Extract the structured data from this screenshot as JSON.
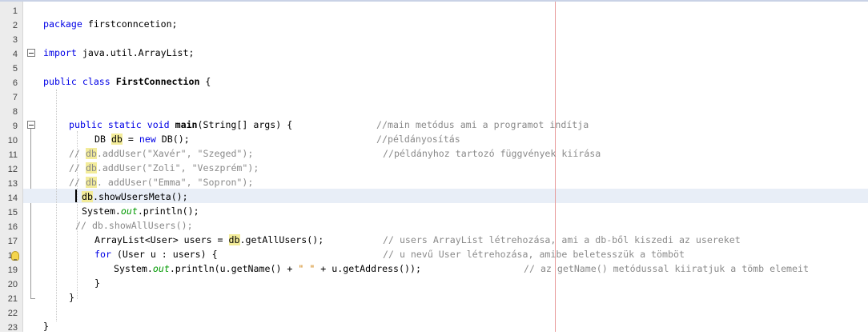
{
  "line_numbers": [
    "1",
    "2",
    "3",
    "4",
    "5",
    "6",
    "7",
    "8",
    "9",
    "10",
    "11",
    "12",
    "13",
    "14",
    "15",
    "16",
    "17",
    "18",
    "19",
    "20",
    "21",
    "22",
    "23"
  ],
  "code": {
    "l2": {
      "kw": "package",
      "rest": " firstconncetion;"
    },
    "l4": {
      "kw": "import",
      "rest": " java.util.ArrayList;"
    },
    "l6": {
      "kw": "public class",
      "name": " FirstConnection",
      "rest": " {"
    },
    "l9": {
      "kw": "public static void",
      "name": " main",
      "rest": "(String[] args) {",
      "comment": "//main metódus ami a programot indítja"
    },
    "l10": {
      "a": "DB ",
      "hl": "db",
      "b": " = ",
      "kw": "new",
      "c": " DB();",
      "comment": "//példányosítás"
    },
    "l11": {
      "a": "// ",
      "hl": "db",
      "b": ".addUser(\"Xavér\", \"Szeged\");",
      "comment": "//példányhoz tartozó függvények kiírása"
    },
    "l12": {
      "a": "// ",
      "hl": "db",
      "b": ".addUser(\"Zoli\", \"Veszprém\");"
    },
    "l13": {
      "a": "// ",
      "hl": "db",
      "b": ". addUser(\"Emma\", \"Sopron\");"
    },
    "l14": {
      "hl": "db",
      "b": ".showUsersMeta();"
    },
    "l15": {
      "a": "System.",
      "fld": "out",
      "b": ".println();"
    },
    "l16": {
      "a": "// db.showAllUsers();"
    },
    "l17": {
      "a": "ArrayList<User> users = ",
      "hl": "db",
      "b": ".getAllUsers();",
      "comment": "// users ArrayList létrehozása, ami a db-ből kiszedi az usereket"
    },
    "l18": {
      "kw": "for",
      "b": " (User u : users) {",
      "comment": "// u nevű User létrehozása, amibe beletesszük a tömböt"
    },
    "l19": {
      "a": "System.",
      "fld": "out",
      "b": ".println(u.getName() + ",
      "str": "\" \"",
      "c": " + u.getAddress());",
      "comment": "// az getName() metódussal kiiratjuk a tömb elemeit"
    },
    "l20": {
      "a": "}"
    },
    "l21": {
      "a": "}"
    },
    "l23": {
      "a": "}"
    }
  },
  "icons": {
    "fold": "fold-toggle-icon",
    "hint": "lightbulb-hint-icon"
  },
  "colors": {
    "keyword": "#0000e6",
    "comment": "#8a8a8a",
    "string": "#ce7b00",
    "field": "#009900",
    "highlight": "#f3ec9a",
    "current_line": "#e8eef7",
    "margin": "#e79a9a"
  }
}
